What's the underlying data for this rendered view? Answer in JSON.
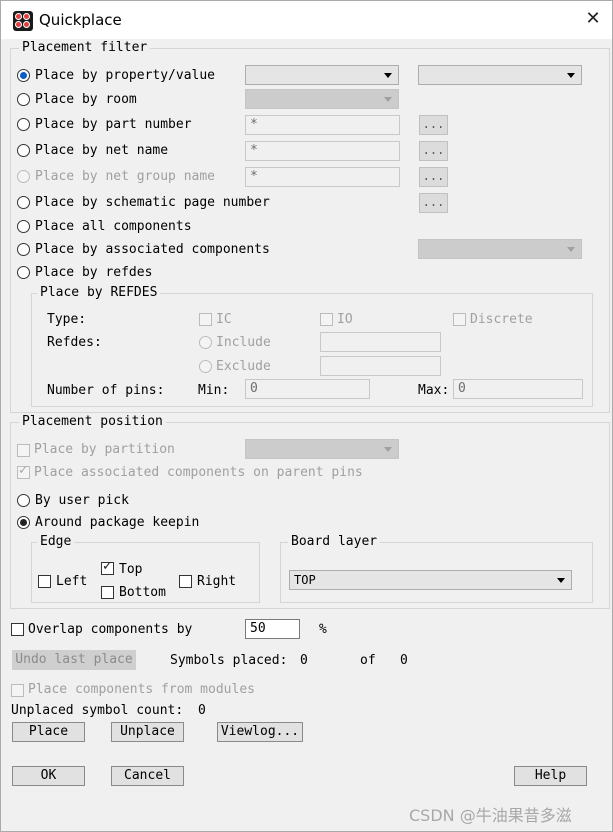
{
  "window": {
    "title": "Quickplace",
    "close_label": "✕"
  },
  "filter": {
    "legend": "Placement filter",
    "options": [
      "Place by property/value",
      "Place by room",
      "Place by part number",
      "Place by net name",
      "Place by net group name",
      "Place by schematic page number",
      "Place all components",
      "Place by associated components",
      "Place by refdes"
    ],
    "part_number_value": "*",
    "net_name_value": "*",
    "net_group_value": "*",
    "dots_label": "...",
    "refdes": {
      "legend": "Place by REFDES",
      "type_label": "Type:",
      "ic_label": "IC",
      "io_label": "IO",
      "discrete_label": "Discrete",
      "refdes_label": "Refdes:",
      "include_label": "Include",
      "exclude_label": "Exclude",
      "pins_label": "Number of pins:",
      "min_label": "Min:",
      "min_value": "0",
      "max_label": "Max:",
      "max_value": "0"
    }
  },
  "position": {
    "legend": "Placement position",
    "partition_label": "Place by partition",
    "assoc_parent_label": "Place associated components on parent pins",
    "user_pick_label": "By user pick",
    "around_keepin_label": "Around package keepin",
    "edge": {
      "legend": "Edge",
      "top_label": "Top",
      "left_label": "Left",
      "right_label": "Right",
      "bottom_label": "Bottom"
    },
    "board_layer": {
      "legend": "Board layer",
      "value": "TOP"
    }
  },
  "overlap": {
    "label": "Overlap components by",
    "value": "50",
    "unit": "%"
  },
  "status": {
    "undo_label": "Undo last place",
    "symbols_placed_label": "Symbols placed:",
    "placed_count": "0",
    "of_label": "of",
    "total_count": "0",
    "modules_label": "Place components from modules",
    "unplaced_label": "Unplaced symbol count:",
    "unplaced_count": "0"
  },
  "buttons": {
    "place": "Place",
    "unplace": "Unplace",
    "viewlog": "Viewlog...",
    "ok": "OK",
    "cancel": "Cancel",
    "help": "Help"
  },
  "watermark": "CSDN @牛油果昔多滋",
  "colors": {
    "radio_selected": "#0b5cc9",
    "dialog_bg": "#f0f0f0"
  }
}
